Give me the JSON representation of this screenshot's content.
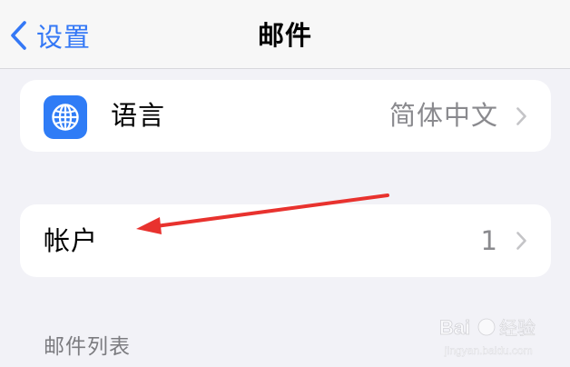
{
  "navbar": {
    "back_label": "设置",
    "title": "邮件"
  },
  "language_row": {
    "label": "语言",
    "value": "简体中文",
    "icon": "globe-icon"
  },
  "accounts_row": {
    "label": "帐户",
    "value": "1"
  },
  "mail_list_section": {
    "header": "邮件列表"
  },
  "annotation": {
    "arrow_color": "#e8322e",
    "target": "accounts_row"
  },
  "watermark": {
    "text": "Bai 经验 jingyan.baidu.com"
  },
  "colors": {
    "accent": "#3478f6",
    "globe_tile": "#2f7cf6",
    "background": "#f2f2f7",
    "secondary_text": "#8a8a8e"
  }
}
